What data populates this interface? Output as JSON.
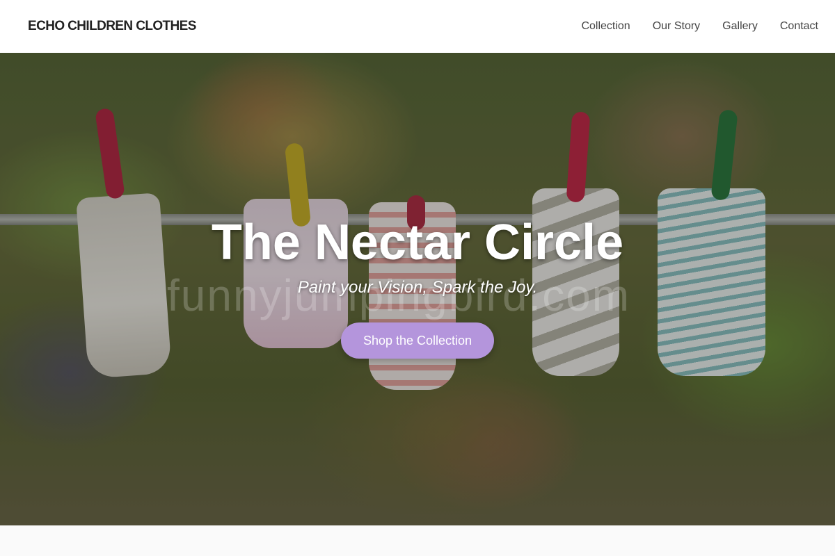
{
  "header": {
    "brand": "ECHO CHILDREN CLOTHES",
    "nav": [
      {
        "label": "Collection"
      },
      {
        "label": "Our Story"
      },
      {
        "label": "Gallery"
      },
      {
        "label": "Contact"
      }
    ]
  },
  "hero": {
    "title": "The Nectar Circle",
    "subtitle": "Paint your Vision, Spark the Joy.",
    "cta_label": "Shop the Collection",
    "watermark": "funnyjumpingbird.com",
    "background_image": "baby socks hanging on a clothesline with clothespins, blurred garden background"
  },
  "colors": {
    "header_bg": "#ffffff",
    "brand_text": "#222222",
    "nav_text": "#444444",
    "cta_bg": "#b495dc",
    "cta_text": "#ffffff",
    "page_bg": "#fafafa"
  }
}
